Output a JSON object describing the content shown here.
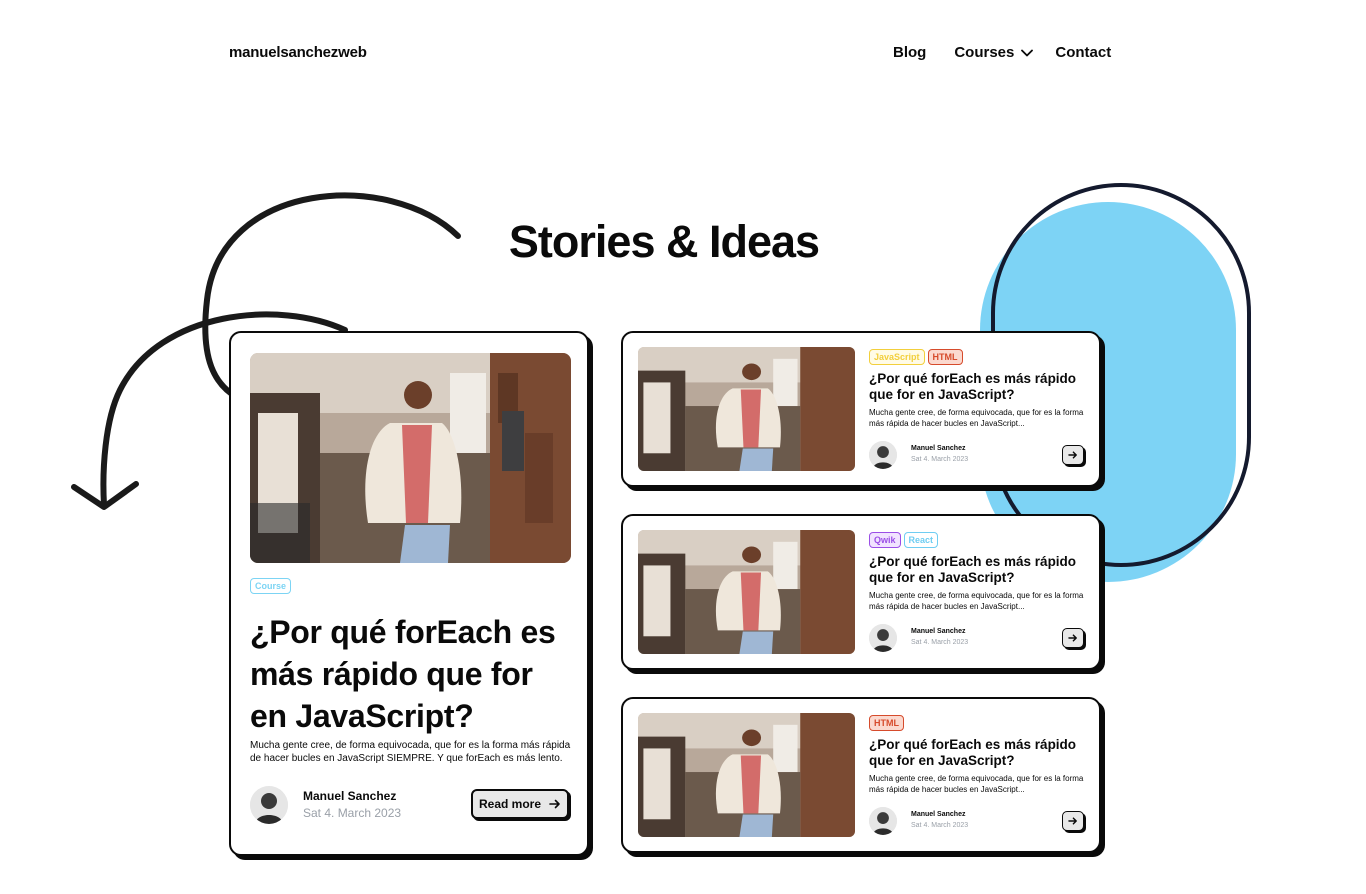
{
  "header": {
    "logo": "manuelsanchezweb",
    "nav": [
      {
        "label": "Blog"
      },
      {
        "label": "Courses"
      },
      {
        "label": "Contact"
      }
    ]
  },
  "main": {
    "title": "Stories & Ideas",
    "featured": {
      "tags": [
        "Course"
      ],
      "title": "¿Por qué forEach es más rápido que for en JavaScript?",
      "description": "Mucha gente cree, de forma equivocada, que for es la forma más rápida de hacer bucles en JavaScript SIEMPRE. Y que forEach es más lento.",
      "author": "Manuel Sanchez",
      "date": "Sat 4. March 2023",
      "cta": "Read more"
    },
    "posts": [
      {
        "tags": [
          "JavaScript",
          "HTML"
        ],
        "title": "¿Por qué forEach es más rápido que for en JavaScript?",
        "description": "Mucha gente cree, de forma equivocada, que for es la forma más rápida de hacer bucles en JavaScript...",
        "author": "Manuel Sanchez",
        "date": "Sat 4. March 2023"
      },
      {
        "tags": [
          "Qwik",
          "React"
        ],
        "title": "¿Por qué forEach es más rápido que for en JavaScript?",
        "description": "Mucha gente cree, de forma equivocada, que for es la forma más rápida de hacer bucles en JavaScript...",
        "author": "Manuel Sanchez",
        "date": "Sat 4. March 2023"
      },
      {
        "tags": [
          "HTML"
        ],
        "title": "¿Por qué forEach es más rápido que for en JavaScript?",
        "description": "Mucha gente cree, de forma equivocada, que for es la forma más rápida de hacer bucles en JavaScript...",
        "author": "Manuel Sanchez",
        "date": "Sat 4. March 2023"
      }
    ]
  },
  "icons": {
    "nav_dropdown": "chevron-down-icon",
    "cta": "arrow-right-icon"
  },
  "colors": {
    "accent_blue": "#7dd3f5",
    "ink": "#0a0a0a",
    "muted_date": "#9aa0a8"
  }
}
